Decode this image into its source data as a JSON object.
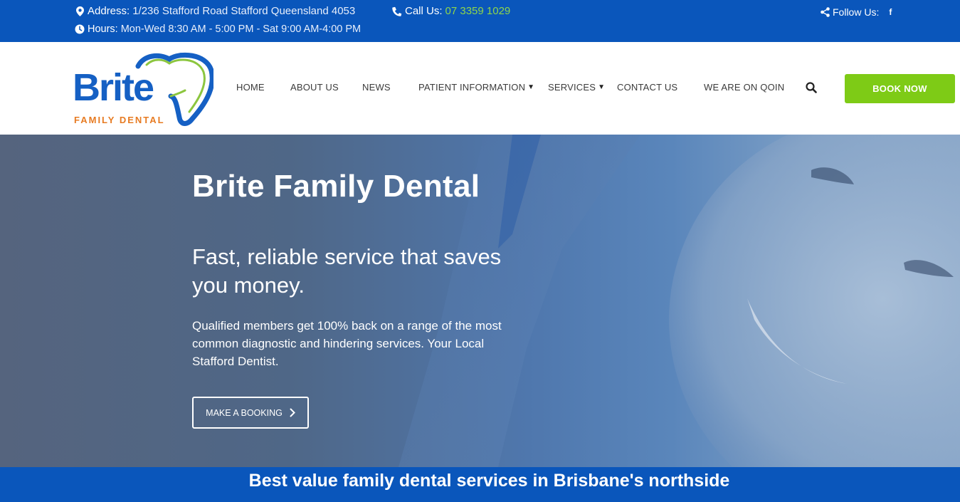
{
  "colors": {
    "brand_blue": "#0a56bb",
    "accent_green": "#7ecb16",
    "phone_green": "#8fd64a",
    "logo_orange": "#e77b22",
    "nav_text": "#3b3b3b"
  },
  "topbar": {
    "address_icon": "map-marker-icon",
    "address_label": "Address:",
    "address_value": "1/236 Stafford Road Stafford Queensland 4053",
    "call_icon": "phone-icon",
    "call_label": "Call Us:",
    "call_value": "07 3359 1029",
    "hours_icon": "clock-icon",
    "hours_label": "Hours:",
    "hours_value": "Mon-Wed 8:30 AM - 5:00 PM - Sat 9:00 AM-4:00 PM",
    "follow_icon": "share-icon",
    "follow_label": "Follow Us:",
    "facebook_label": "f"
  },
  "logo": {
    "word": "Brite",
    "subtitle": "FAMILY DENTAL"
  },
  "nav": {
    "items": [
      {
        "label": "HOME"
      },
      {
        "label": "ABOUT US"
      },
      {
        "label": "NEWS"
      },
      {
        "label": "PATIENT INFORMATION",
        "dropdown": true
      },
      {
        "label": "SERVICES",
        "dropdown": true
      },
      {
        "label": "CONTACT US"
      },
      {
        "label": "WE ARE ON QOIN"
      }
    ],
    "caret": "▼",
    "search_icon": "search-icon",
    "book_label": "BOOK NOW"
  },
  "hero": {
    "title": "Brite Family Dental",
    "subtitle": "Fast, reliable service that saves you money.",
    "text": "Qualified members get 100% back on a range of the most common diagnostic and hindering services. Your Local Stafford Dentist.",
    "button_label": "MAKE A BOOKING",
    "button_icon": "chevron-right-icon"
  },
  "band": {
    "text": "Best value family dental services in Brisbane's northside"
  }
}
